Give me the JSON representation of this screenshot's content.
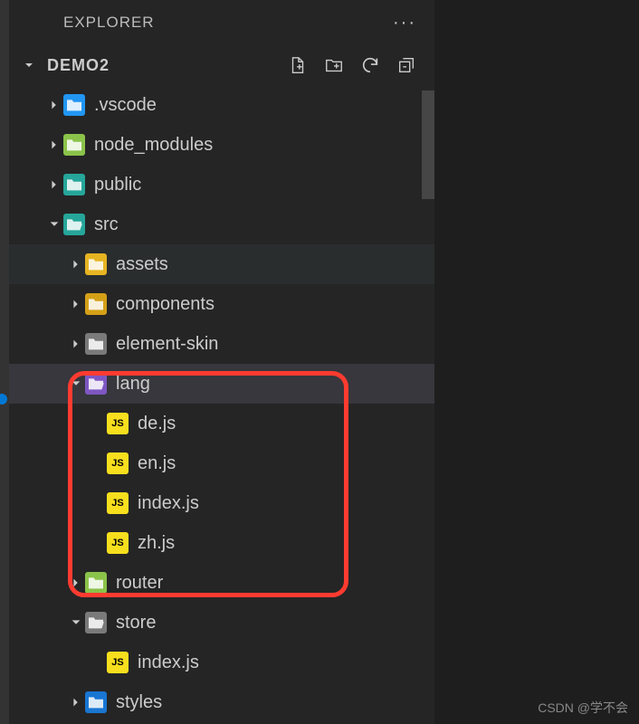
{
  "sidebar": {
    "title": "EXPLORER",
    "section": "DEMO2"
  },
  "tree": {
    "items": [
      {
        "name": ".vscode",
        "type": "folder",
        "expanded": false,
        "indent": 1,
        "icon": "folder-blue"
      },
      {
        "name": "node_modules",
        "type": "folder",
        "expanded": false,
        "indent": 1,
        "icon": "folder-green"
      },
      {
        "name": "public",
        "type": "folder",
        "expanded": false,
        "indent": 1,
        "icon": "folder-teal"
      },
      {
        "name": "src",
        "type": "folder",
        "expanded": true,
        "indent": 1,
        "icon": "folder-teal"
      },
      {
        "name": "assets",
        "type": "folder",
        "expanded": false,
        "indent": 2,
        "icon": "folder-yellow",
        "highlight": true
      },
      {
        "name": "components",
        "type": "folder",
        "expanded": false,
        "indent": 2,
        "icon": "folder-yellow2"
      },
      {
        "name": "element-skin",
        "type": "folder",
        "expanded": false,
        "indent": 2,
        "icon": "folder-gray"
      },
      {
        "name": "lang",
        "type": "folder",
        "expanded": true,
        "indent": 2,
        "icon": "folder-purple",
        "selected": true
      },
      {
        "name": "de.js",
        "type": "file",
        "indent": 3,
        "icon": "js"
      },
      {
        "name": "en.js",
        "type": "file",
        "indent": 3,
        "icon": "js"
      },
      {
        "name": "index.js",
        "type": "file",
        "indent": 3,
        "icon": "js"
      },
      {
        "name": "zh.js",
        "type": "file",
        "indent": 3,
        "icon": "js"
      },
      {
        "name": "router",
        "type": "folder",
        "expanded": false,
        "indent": 2,
        "icon": "folder-green"
      },
      {
        "name": "store",
        "type": "folder",
        "expanded": true,
        "indent": 2,
        "icon": "folder-gray"
      },
      {
        "name": "index.js",
        "type": "file",
        "indent": 3,
        "icon": "js"
      },
      {
        "name": "styles",
        "type": "folder",
        "expanded": false,
        "indent": 2,
        "icon": "folder-dblue"
      }
    ]
  },
  "watermark": "CSDN @学不会"
}
